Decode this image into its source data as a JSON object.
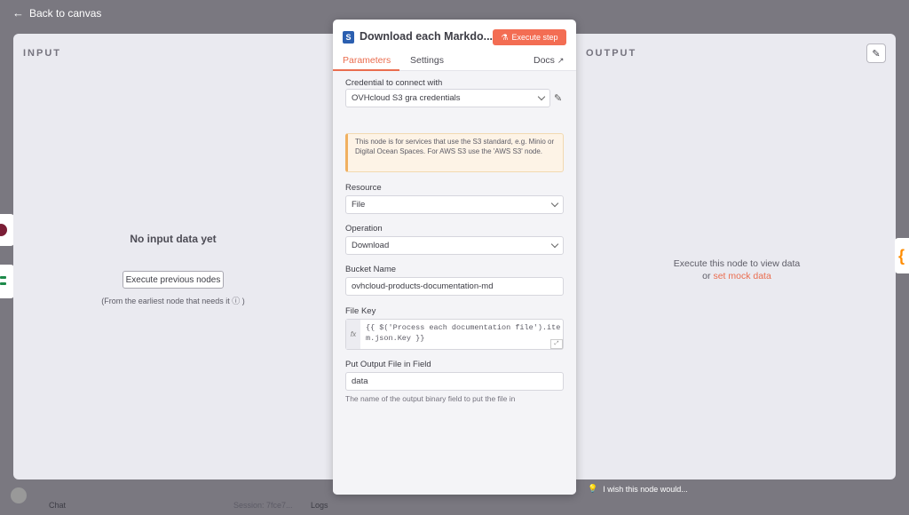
{
  "topbar": {
    "back_label": "Back to canvas"
  },
  "input_panel": {
    "title": "INPUT",
    "empty_title": "No input data yet",
    "execute_previous_label": "Execute previous nodes",
    "note": "(From the earliest node that needs it ⓘ )"
  },
  "output_panel": {
    "title": "OUTPUT",
    "message": "Execute this node to view data",
    "or_text": "or",
    "mock_link": "set mock data"
  },
  "modal": {
    "title": "Download each Markdo...",
    "execute_step_label": "Execute step",
    "tabs": {
      "parameters": "Parameters",
      "settings": "Settings",
      "docs": "Docs"
    },
    "credential": {
      "label": "Credential to connect with",
      "value": "OVHcloud S3 gra credentials"
    },
    "notice": "This node is for services that use the S3 standard, e.g. Minio or Digital Ocean Spaces. For AWS S3 use the 'AWS S3' node.",
    "resource": {
      "label": "Resource",
      "value": "File"
    },
    "operation": {
      "label": "Operation",
      "value": "Download"
    },
    "bucket": {
      "label": "Bucket Name",
      "value": "ovhcloud-products-documentation-md"
    },
    "file_key": {
      "label": "File Key",
      "value": "{{ $('Process each documentation file').item.json.Key }}",
      "fx": "fx"
    },
    "output_field": {
      "label": "Put Output File in Field",
      "value": "data",
      "hint": "The name of the output binary field to put the file in"
    }
  },
  "bottom": {
    "chat": "Chat",
    "session": "Session: 7fce7...",
    "logs": "Logs",
    "wish": "I wish this node would..."
  },
  "colors": {
    "accent": "#ea6d4f",
    "execute_button": "#f36d53",
    "backdrop": "#7a7880",
    "panel": "#eaeaf0"
  }
}
